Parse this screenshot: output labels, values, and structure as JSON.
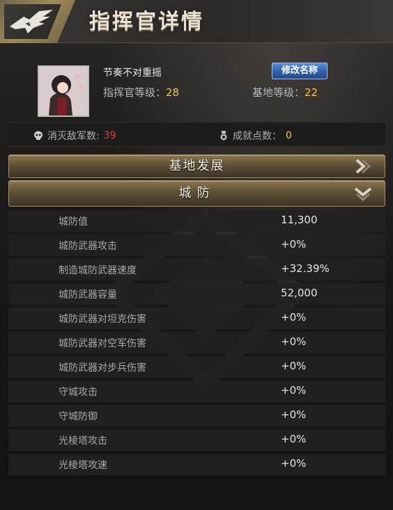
{
  "header": {
    "title": "指挥官详情",
    "logo_icon": "eagle-emblem-icon"
  },
  "profile": {
    "name": "节奏不对重摇",
    "rename_label": "修改名称",
    "commander_level_label": "指挥官等级：",
    "commander_level": "28",
    "base_level_label": "基地等级：",
    "base_level": "22"
  },
  "stats": {
    "kills_label": "消灭敌军数:",
    "kills_value": "39",
    "achievement_label": "成就点数：",
    "achievement_value": "0",
    "kills_icon": "skull-icon",
    "achievement_icon": "medal-icon"
  },
  "sections": {
    "base_dev": {
      "label": "基地发展",
      "icon": "chevron-right-icon"
    },
    "defense": {
      "label": "城防",
      "icon": "chevron-down-icon"
    }
  },
  "defense_rows": [
    {
      "label": "城防值",
      "value": "11,300"
    },
    {
      "label": "城防武器攻击",
      "value": "+0%"
    },
    {
      "label": "制造城防武器速度",
      "value": "+32.39%"
    },
    {
      "label": "城防武器容量",
      "value": "52,000"
    },
    {
      "label": "城防武器对坦克伤害",
      "value": "+0%"
    },
    {
      "label": "城防武器对空军伤害",
      "value": "+0%"
    },
    {
      "label": "城防武器对步兵伤害",
      "value": "+0%"
    },
    {
      "label": "守城攻击",
      "value": "+0%"
    },
    {
      "label": "守城防御",
      "value": "+0%"
    },
    {
      "label": "光棱塔攻击",
      "value": "+0%"
    },
    {
      "label": "光棱塔攻速",
      "value": "+0%"
    }
  ],
  "colors": {
    "accent_gold": "#f0c846",
    "kills_red": "#e23b3b",
    "button_blue": "#2f5fa8"
  }
}
